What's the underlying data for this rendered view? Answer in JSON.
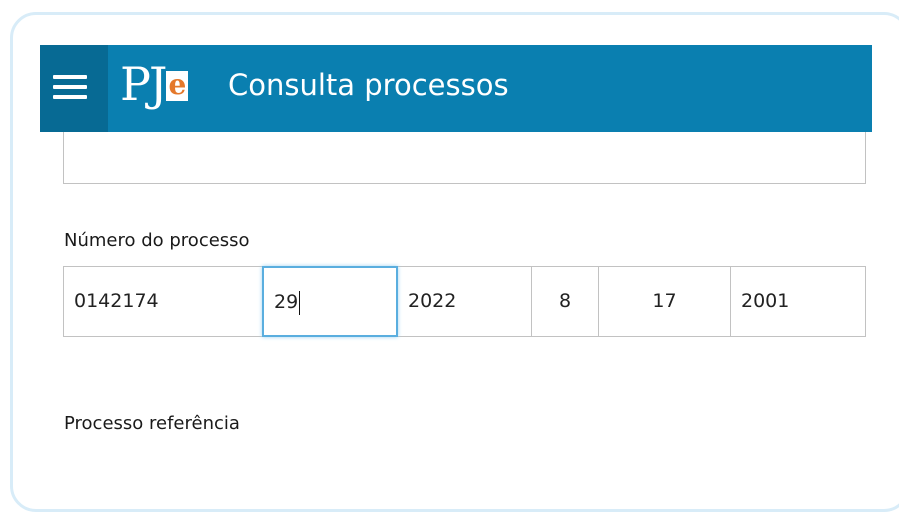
{
  "header": {
    "logo_text": "PJ",
    "logo_e": "e",
    "title": "Consulta processos"
  },
  "numero_processo": {
    "label": "Número do processo",
    "segments": [
      "0142174",
      "29",
      "2022",
      "8",
      "17",
      "2001"
    ]
  },
  "processo_referencia": {
    "label": "Processo referência"
  },
  "colors": {
    "header_bg": "#0a7fb0",
    "menu_bg": "#076a94",
    "logo_accent": "#e4782b",
    "focus_border": "#5aaedf"
  }
}
